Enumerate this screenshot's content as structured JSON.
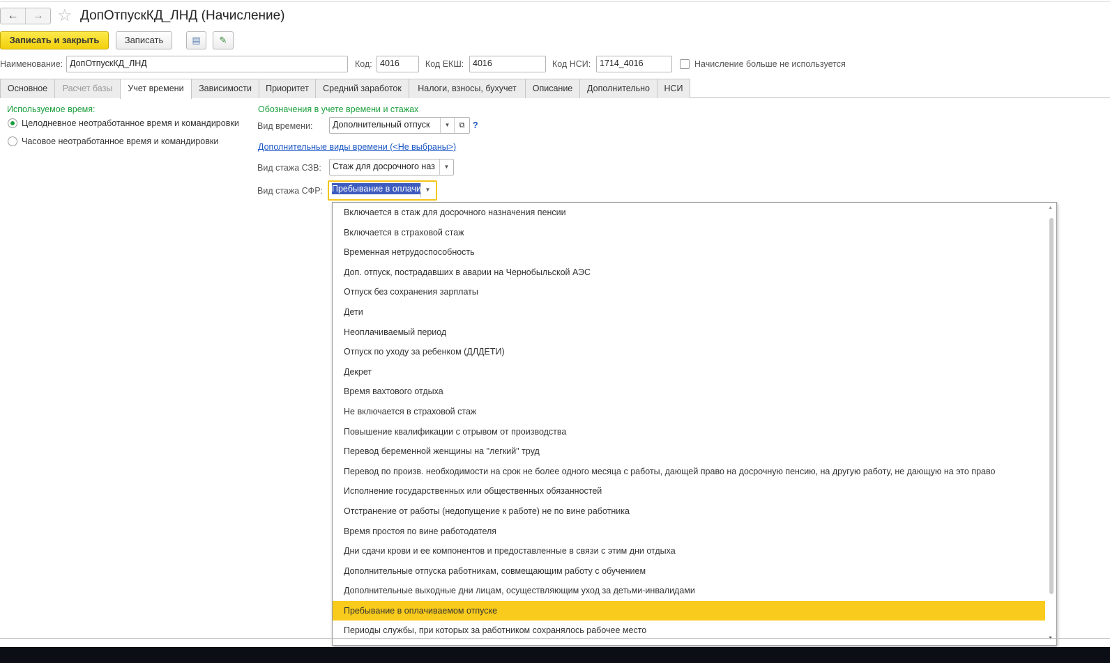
{
  "title": "ДопОтпускКД_ЛНД (Начисление)",
  "toolbar": {
    "save_close": "Записать и закрыть",
    "save": "Записать"
  },
  "fields": {
    "name_label": "Наименование:",
    "name_value": "ДопОтпускКД_ЛНД",
    "code_label": "Код:",
    "code_value": "4016",
    "ekw_label": "Код ЕКШ:",
    "ekw_value": "4016",
    "nsi_label": "Код НСИ:",
    "nsi_value": "1714_4016",
    "unused_label": "Начисление больше не используется"
  },
  "tabs": [
    "Основное",
    "Расчет базы",
    "Учет времени",
    "Зависимости",
    "Приоритет",
    "Средний заработок",
    "Налоги, взносы, бухучет",
    "Описание",
    "Дополнительно",
    "НСИ"
  ],
  "left": {
    "heading": "Используемое время:",
    "options": [
      "Целодневное неотработанное время и командировки",
      "Часовое неотработанное время и командировки"
    ]
  },
  "right": {
    "heading": "Обозначения в учете времени и стажах",
    "time_label": "Вид времени:",
    "time_value": "Дополнительный отпуск",
    "help": "?",
    "extra_link": "Дополнительные виды времени (<Не выбраны>)",
    "szv_label": "Вид стажа СЗВ:",
    "szv_value": "Стаж для досрочного наз",
    "sfr_label": "Вид стажа СФР:",
    "sfr_value": "Пребывание в оплачивае"
  },
  "dropdown": [
    "Включается в стаж для досрочного назначения пенсии",
    "Включается в страховой стаж",
    "Временная нетрудоспособность",
    "Доп. отпуск, пострадавших в аварии на Чернобыльской АЭС",
    "Отпуск без сохранения зарплаты",
    "Дети",
    "Неоплачиваемый период",
    "Отпуск по уходу за ребенком (ДЛДЕТИ)",
    "Декрет",
    "Время вахтового отдыха",
    "Не включается в страховой стаж",
    "Повышение квалификации с отрывом от производства",
    "Перевод беременной женщины на \"легкий\" труд",
    "Перевод по произв. необходимости на срок не более одного месяца с работы, дающей право на досрочную пенсию, на другую работу, не дающую на это право",
    "Исполнение государственных или общественных обязанностей",
    "Отстранение от работы (недопущение к работе) не по вине работника",
    "Время простоя по вине работодателя",
    "Дни сдачи крови и ее компонентов и предоставленные в связи с этим дни отдыха",
    "Дополнительные отпуска работникам, совмещающим работу с обучением",
    "Дополнительные выходные дни лицам, осуществляющим уход за детьми-инвалидами",
    "Пребывание в оплачиваемом отпуске",
    "Периоды службы, при которых за работником сохранялось рабочее место"
  ],
  "selected_index": 20
}
